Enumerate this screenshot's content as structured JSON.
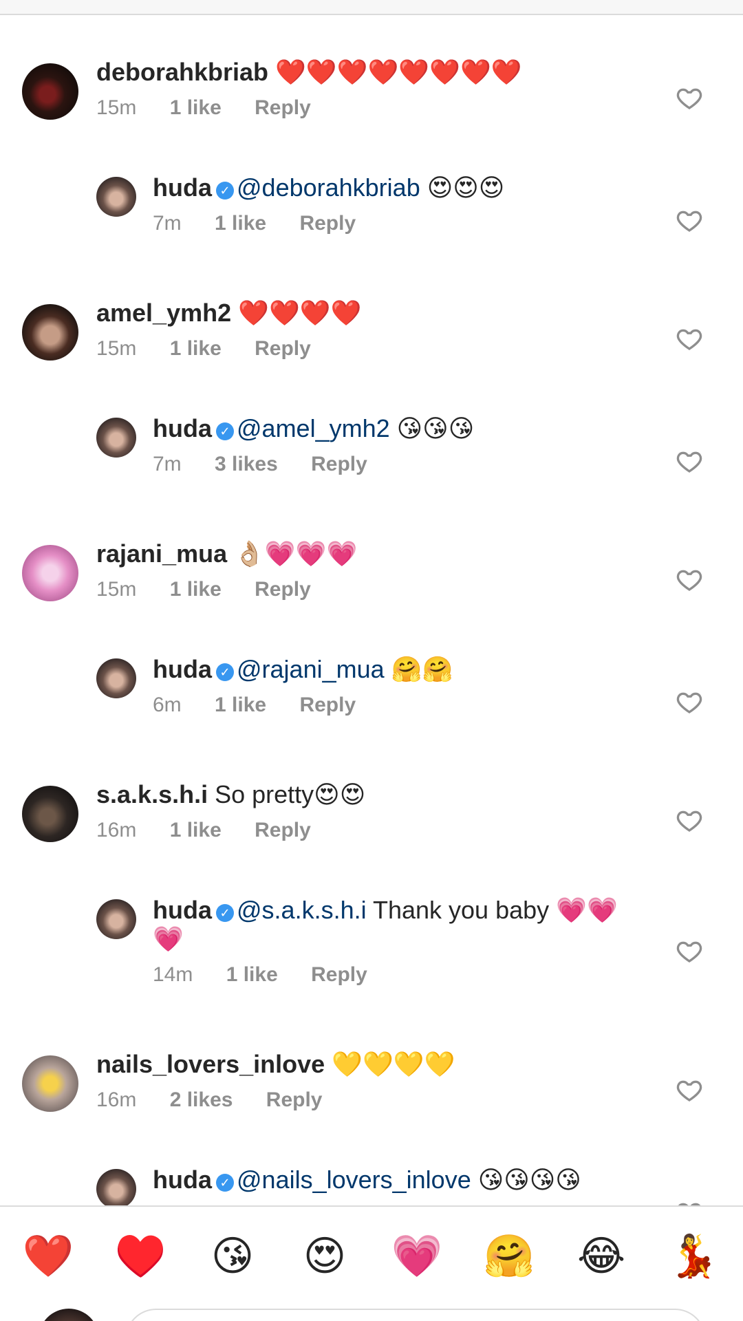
{
  "comments": [
    {
      "username": "deborahkbriab",
      "verified": false,
      "mention": "",
      "text": " ❤️❤️❤️❤️❤️❤️❤️❤️",
      "time": "15m",
      "likes": "1 like",
      "reply_label": "Reply",
      "is_reply": false
    },
    {
      "username": "huda",
      "verified": true,
      "mention": "@deborahkbriab",
      "text": " 😍😍😍",
      "time": "7m",
      "likes": "1 like",
      "reply_label": "Reply",
      "is_reply": true
    },
    {
      "username": "amel_ymh2",
      "verified": false,
      "mention": "",
      "text": " ❤️❤️❤️❤️",
      "time": "15m",
      "likes": "1 like",
      "reply_label": "Reply",
      "is_reply": false
    },
    {
      "username": "huda",
      "verified": true,
      "mention": "@amel_ymh2",
      "text": " 😘😘😘",
      "time": "7m",
      "likes": "3 likes",
      "reply_label": "Reply",
      "is_reply": true
    },
    {
      "username": "rajani_mua",
      "verified": false,
      "mention": "",
      "text": " 👌🏼💗💗💗",
      "time": "15m",
      "likes": "1 like",
      "reply_label": "Reply",
      "is_reply": false
    },
    {
      "username": "huda",
      "verified": true,
      "mention": "@rajani_mua",
      "text": " 🤗🤗",
      "time": "6m",
      "likes": "1 like",
      "reply_label": "Reply",
      "is_reply": true
    },
    {
      "username": "s.a.k.s.h.i",
      "verified": false,
      "mention": "",
      "text": " So pretty😍😍",
      "time": "16m",
      "likes": "1 like",
      "reply_label": "Reply",
      "is_reply": false
    },
    {
      "username": "huda",
      "verified": true,
      "mention": "@s.a.k.s.h.i",
      "text": " Thank you baby 💗💗💗",
      "time": "14m",
      "likes": "1 like",
      "reply_label": "Reply",
      "is_reply": true
    },
    {
      "username": "nails_lovers_inlove",
      "verified": false,
      "mention": "",
      "text": " 💛💛💛💛",
      "time": "16m",
      "likes": "2 likes",
      "reply_label": "Reply",
      "is_reply": false
    },
    {
      "username": "huda",
      "verified": true,
      "mention": "@nails_lovers_inlove",
      "text": " 😘😘😘😘",
      "time": "",
      "likes": "",
      "reply_label": "",
      "is_reply": true
    }
  ],
  "emoji_bar": [
    "❤️",
    "♥️",
    "😘",
    "😍",
    "💗",
    "🤗",
    "😂",
    "💃"
  ],
  "icons": {
    "like": "heart-outline-icon",
    "verified": "verified-badge-icon"
  },
  "colors": {
    "verified": "#3897f0",
    "mention": "#00376b",
    "meta": "#8e8e8e"
  }
}
